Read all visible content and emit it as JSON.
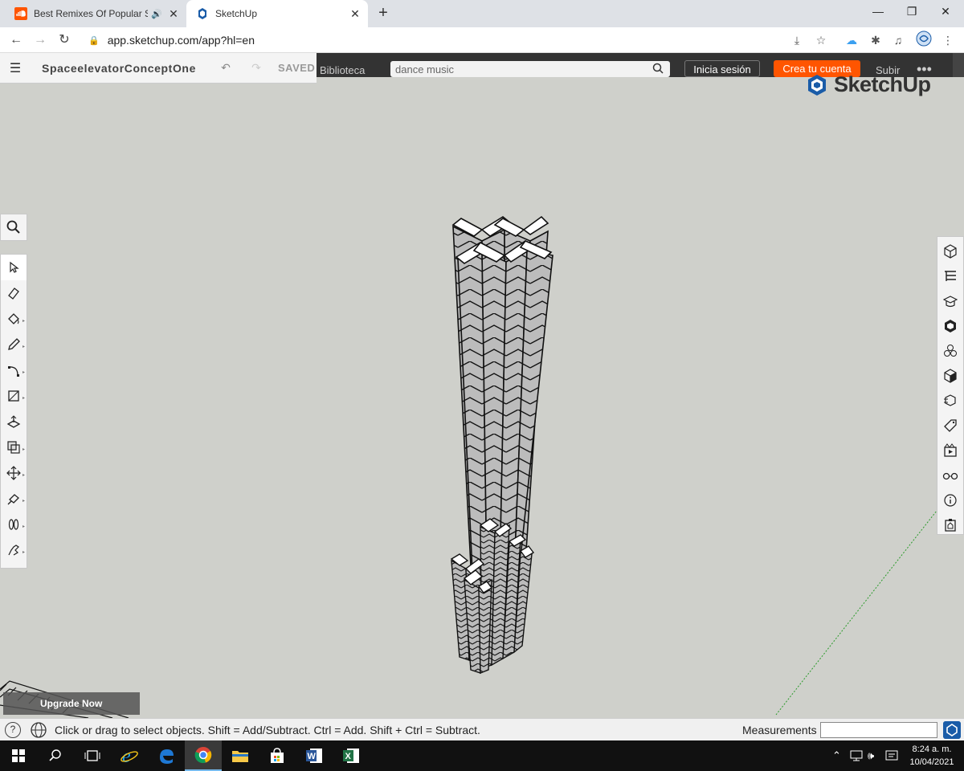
{
  "browser": {
    "tabs": [
      {
        "title": "Best Remixes Of Popular Son",
        "audio_icon": "speaker-icon",
        "favicon": "soundcloud-icon"
      },
      {
        "title": "SketchUp",
        "favicon": "sketchup-icon"
      }
    ],
    "new_tab": "+",
    "window_controls": {
      "minimize": "—",
      "restore": "❐",
      "close": "✕"
    },
    "url": "app.sketchup.com/app?hl=en",
    "nav": {
      "back": "←",
      "forward": "→",
      "reload": "↻"
    }
  },
  "site_strip": {
    "library": "Biblioteca",
    "search_value": "dance music",
    "login": "Inicia sesión",
    "signup": "Crea tu cuenta",
    "upload": "Subir",
    "more": "•••",
    "accent": "#ff5500"
  },
  "sketchup": {
    "model_name": "SpaceelevatorConceptOne",
    "saved_label": "SAVED",
    "logo_text": "SketchUp",
    "upgrade_label": "Upgrade Now",
    "left_tools": [
      "select-icon",
      "eraser-icon",
      "paint-bucket-icon",
      "pencil-icon",
      "arc-icon",
      "rectangle-icon",
      "push-pull-icon",
      "offset-icon",
      "move-icon",
      "tape-measure-icon",
      "walk-icon",
      "orbit-hand-icon"
    ],
    "right_tools": [
      "entity-info-icon",
      "outliner-icon",
      "instructor-icon",
      "components-icon",
      "materials-icon",
      "styles-icon",
      "scenes-icon",
      "tags-icon",
      "display-icon",
      "views-icon",
      "info-icon",
      "export-icon"
    ]
  },
  "status": {
    "hint": "Click or drag to select objects. Shift = Add/Subtract. Ctrl = Add. Shift + Ctrl = Subtract.",
    "measurements_label": "Measurements"
  },
  "taskbar": {
    "time": "8:24 a. m.",
    "date": "10/04/2021"
  }
}
